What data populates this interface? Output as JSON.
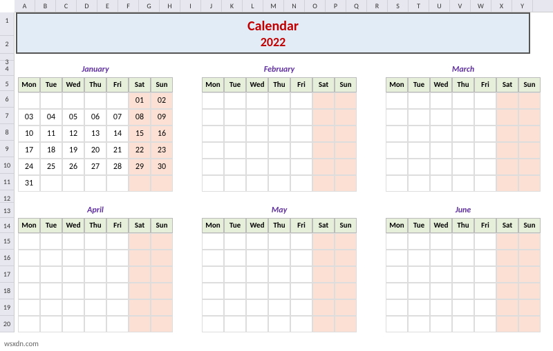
{
  "columns": [
    "A",
    "B",
    "C",
    "D",
    "E",
    "F",
    "G",
    "H",
    "I",
    "J",
    "K",
    "L",
    "M",
    "N",
    "O",
    "P",
    "Q",
    "R",
    "S",
    "T",
    "U",
    "V",
    "W",
    "X",
    "Y"
  ],
  "rows": [
    "1",
    "2",
    "3",
    "4",
    "5",
    "6",
    "7",
    "8",
    "9",
    "10",
    "11",
    "12",
    "13",
    "14",
    "15",
    "16",
    "17",
    "18",
    "19",
    "20"
  ],
  "title": {
    "line1": "Calendar",
    "line2": "2022"
  },
  "dayNames": [
    "Mon",
    "Tue",
    "Wed",
    "Thu",
    "Fri",
    "Sat",
    "Sun"
  ],
  "months": [
    {
      "name": "January",
      "weeks": [
        [
          "",
          "",
          "",
          "",
          "",
          "01",
          "02"
        ],
        [
          "03",
          "04",
          "05",
          "06",
          "07",
          "08",
          "09"
        ],
        [
          "10",
          "11",
          "12",
          "13",
          "14",
          "15",
          "16"
        ],
        [
          "17",
          "18",
          "19",
          "20",
          "21",
          "22",
          "23"
        ],
        [
          "24",
          "25",
          "26",
          "27",
          "28",
          "29",
          "30"
        ],
        [
          "31",
          "",
          "",
          "",
          "",
          "",
          ""
        ]
      ]
    },
    {
      "name": "February",
      "weeks": [
        [
          "",
          "",
          "",
          "",
          "",
          "",
          ""
        ],
        [
          "",
          "",
          "",
          "",
          "",
          "",
          ""
        ],
        [
          "",
          "",
          "",
          "",
          "",
          "",
          ""
        ],
        [
          "",
          "",
          "",
          "",
          "",
          "",
          ""
        ],
        [
          "",
          "",
          "",
          "",
          "",
          "",
          ""
        ],
        [
          "",
          "",
          "",
          "",
          "",
          "",
          ""
        ]
      ]
    },
    {
      "name": "March",
      "weeks": [
        [
          "",
          "",
          "",
          "",
          "",
          "",
          ""
        ],
        [
          "",
          "",
          "",
          "",
          "",
          "",
          ""
        ],
        [
          "",
          "",
          "",
          "",
          "",
          "",
          ""
        ],
        [
          "",
          "",
          "",
          "",
          "",
          "",
          ""
        ],
        [
          "",
          "",
          "",
          "",
          "",
          "",
          ""
        ],
        [
          "",
          "",
          "",
          "",
          "",
          "",
          ""
        ]
      ]
    },
    {
      "name": "April",
      "weeks": [
        [
          "",
          "",
          "",
          "",
          "",
          "",
          ""
        ],
        [
          "",
          "",
          "",
          "",
          "",
          "",
          ""
        ],
        [
          "",
          "",
          "",
          "",
          "",
          "",
          ""
        ],
        [
          "",
          "",
          "",
          "",
          "",
          "",
          ""
        ],
        [
          "",
          "",
          "",
          "",
          "",
          "",
          ""
        ],
        [
          "",
          "",
          "",
          "",
          "",
          "",
          ""
        ]
      ]
    },
    {
      "name": "May",
      "weeks": [
        [
          "",
          "",
          "",
          "",
          "",
          "",
          ""
        ],
        [
          "",
          "",
          "",
          "",
          "",
          "",
          ""
        ],
        [
          "",
          "",
          "",
          "",
          "",
          "",
          ""
        ],
        [
          "",
          "",
          "",
          "",
          "",
          "",
          ""
        ],
        [
          "",
          "",
          "",
          "",
          "",
          "",
          ""
        ],
        [
          "",
          "",
          "",
          "",
          "",
          "",
          ""
        ]
      ]
    },
    {
      "name": "June",
      "weeks": [
        [
          "",
          "",
          "",
          "",
          "",
          "",
          ""
        ],
        [
          "",
          "",
          "",
          "",
          "",
          "",
          ""
        ],
        [
          "",
          "",
          "",
          "",
          "",
          "",
          ""
        ],
        [
          "",
          "",
          "",
          "",
          "",
          "",
          ""
        ],
        [
          "",
          "",
          "",
          "",
          "",
          "",
          ""
        ],
        [
          "",
          "",
          "",
          "",
          "",
          "",
          ""
        ]
      ]
    }
  ],
  "siteLabel": "wsxdn.com"
}
